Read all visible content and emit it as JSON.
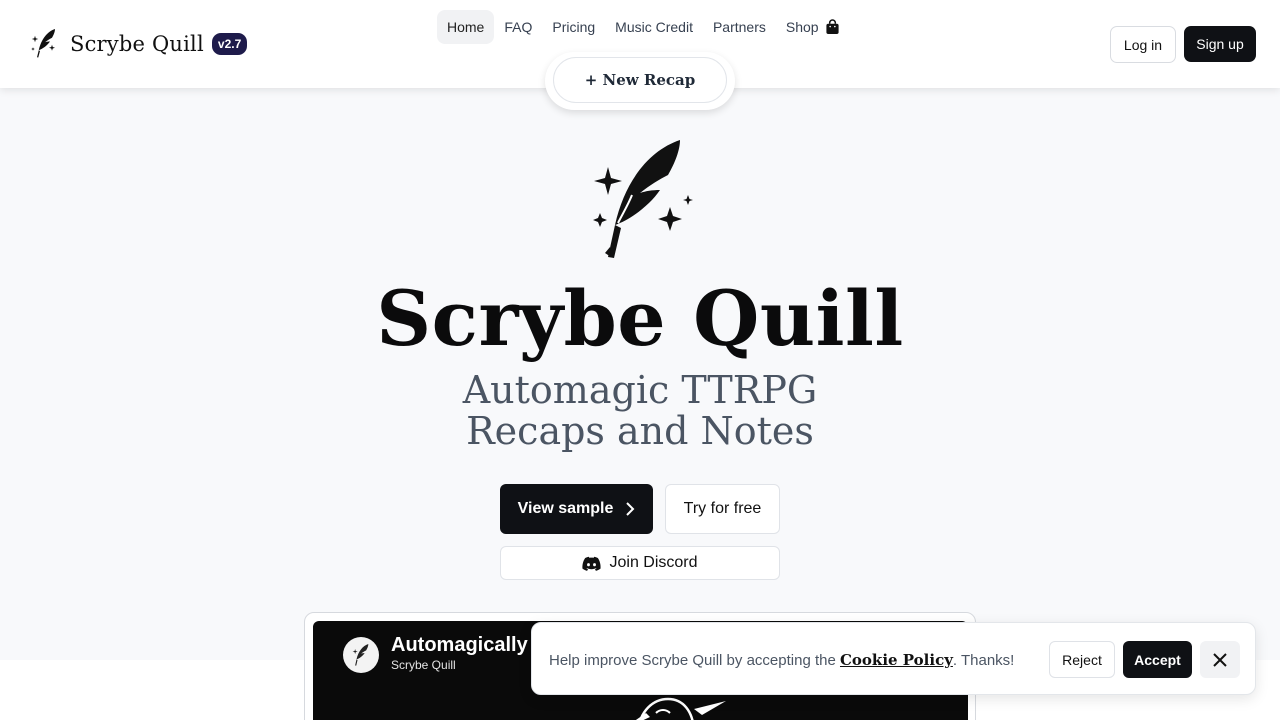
{
  "header": {
    "brand_name": "Scrybe Quill",
    "version": "v2.7",
    "nav": [
      {
        "label": "Home",
        "active": true
      },
      {
        "label": "FAQ"
      },
      {
        "label": "Pricing"
      },
      {
        "label": "Music Credit"
      },
      {
        "label": "Partners"
      },
      {
        "label": "Shop"
      }
    ],
    "login_label": "Log in",
    "signup_label": "Sign up",
    "new_recap_label": "+ New Recap"
  },
  "hero": {
    "title": "Scrybe Quill",
    "subtitle_line1": "Automagic TTRPG",
    "subtitle_line2": "Recaps and Notes",
    "view_sample_label": "View sample",
    "try_free_label": "Try for free",
    "discord_label": "Join Discord"
  },
  "video": {
    "title": "Automagically G",
    "channel": "Scrybe Quill"
  },
  "cookie": {
    "text_before": "Help improve Scrybe Quill by accepting the ",
    "link_label": "Cookie Policy",
    "text_after": ". Thanks!",
    "reject_label": "Reject",
    "accept_label": "Accept"
  },
  "colors": {
    "primary_dark": "#0f1115",
    "badge": "#1e1b4b",
    "page_bg": "#f8f9fb",
    "subtitle": "#4b5563"
  },
  "icons": {
    "logo": "quill-sparkles-icon",
    "shop": "shopping-bag-icon",
    "chevron": "chevron-right-icon",
    "discord": "discord-icon",
    "close": "close-icon"
  }
}
